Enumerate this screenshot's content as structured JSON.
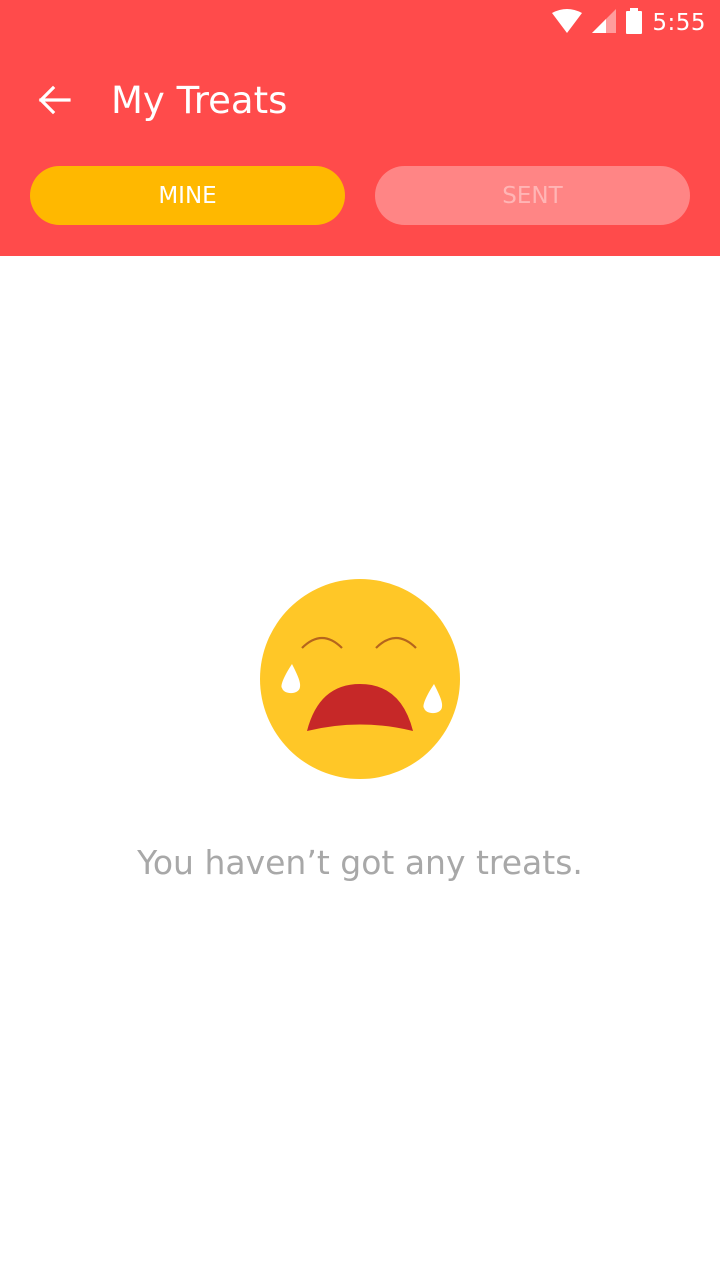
{
  "status_bar": {
    "time": "5:55",
    "icons": [
      "wifi-icon",
      "cellular-signal-icon",
      "battery-icon"
    ]
  },
  "toolbar": {
    "title": "My Treats",
    "back_icon": "arrow-back-icon"
  },
  "tabs": [
    {
      "label": "MINE",
      "selected": true
    },
    {
      "label": "SENT",
      "selected": false
    }
  ],
  "empty_state": {
    "icon": "crying-face-icon",
    "message": "You haven’t got any treats."
  },
  "colors": {
    "header": "#FF4B4B",
    "tab_active": "#FFB800",
    "tab_inactive": "#FF8585",
    "empty_text": "#A8A8A8",
    "emoji_face": "#FFC727",
    "emoji_mouth": "#C62828"
  }
}
